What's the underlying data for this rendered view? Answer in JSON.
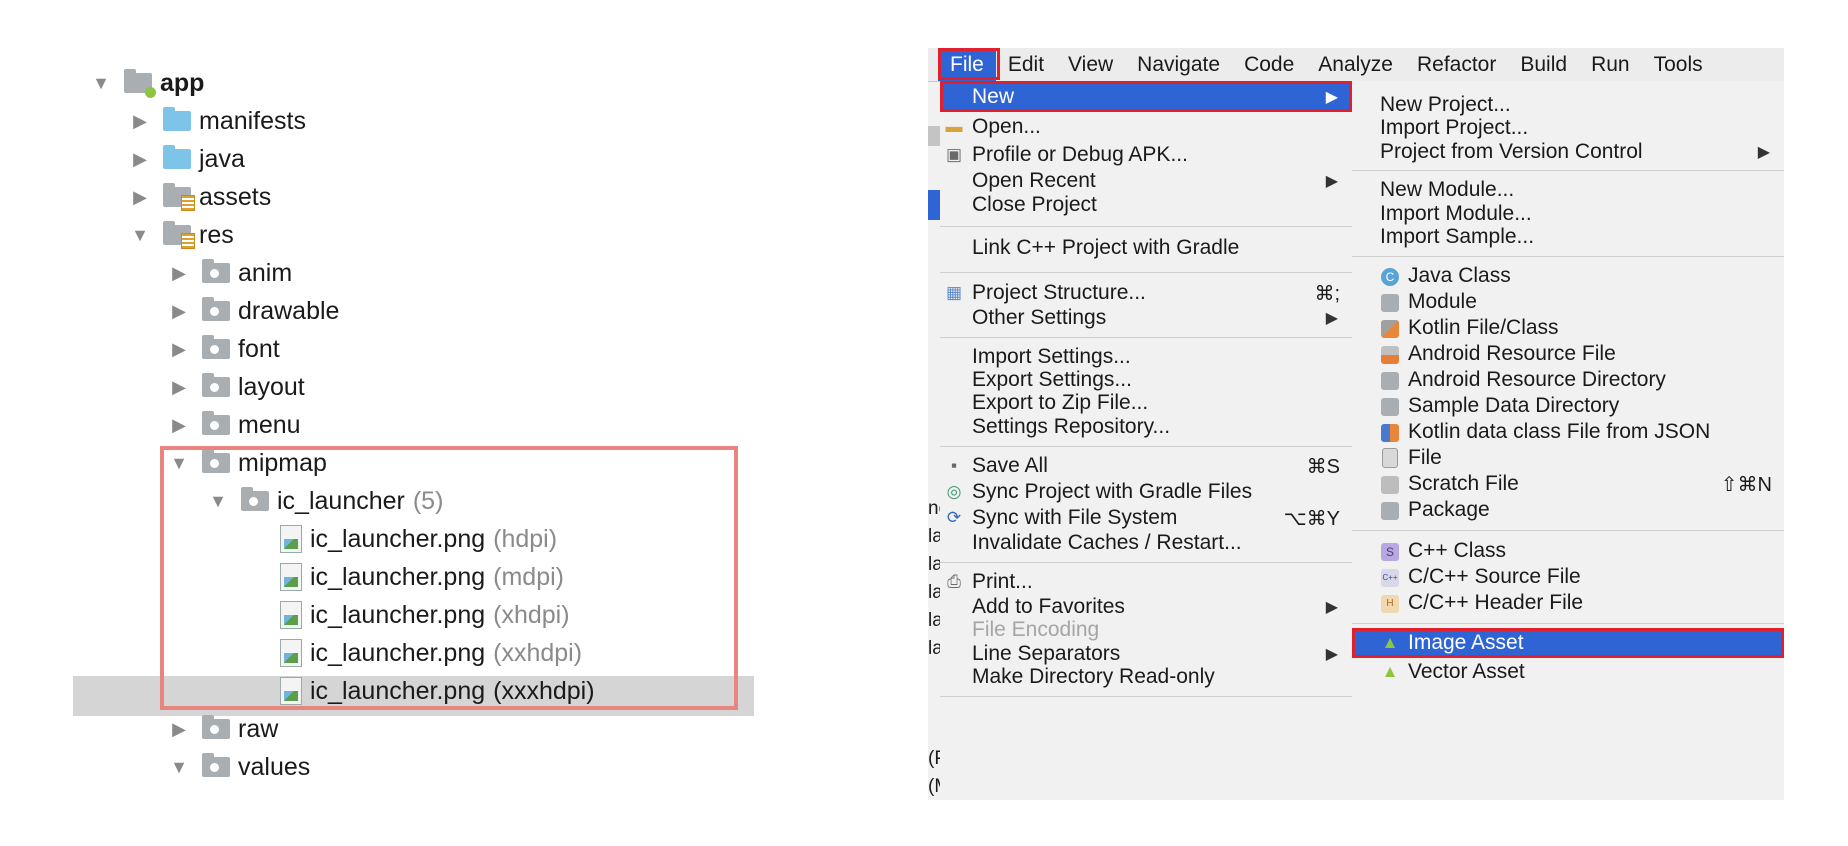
{
  "tree": {
    "rows": [
      {
        "label": "app",
        "arrow": "▼",
        "bold": true
      },
      {
        "label": "manifests",
        "arrow": "▶"
      },
      {
        "label": "java",
        "arrow": "▶"
      },
      {
        "label": "assets",
        "arrow": "▶"
      },
      {
        "label": "res",
        "arrow": "▼"
      },
      {
        "label": "anim",
        "arrow": "▶"
      },
      {
        "label": "drawable",
        "arrow": "▶"
      },
      {
        "label": "font",
        "arrow": "▶"
      },
      {
        "label": "layout",
        "arrow": "▶"
      },
      {
        "label": "menu",
        "arrow": "▶"
      },
      {
        "label": "mipmap",
        "arrow": "▼"
      },
      {
        "label": "ic_launcher",
        "arrow": "▼",
        "qualifier": "(5)"
      },
      {
        "label": "ic_launcher.png",
        "qualifier": "(hdpi)"
      },
      {
        "label": "ic_launcher.png",
        "qualifier": "(mdpi)"
      },
      {
        "label": "ic_launcher.png",
        "qualifier": "(xhdpi)"
      },
      {
        "label": "ic_launcher.png",
        "qualifier": "(xxhdpi)"
      },
      {
        "label": "ic_launcher.png",
        "qualifier": "(xxxhdpi)"
      },
      {
        "label": "raw",
        "arrow": "▶"
      },
      {
        "label": "values",
        "arrow": "▼"
      }
    ]
  },
  "menubar": [
    "File",
    "Edit",
    "View",
    "Navigate",
    "Code",
    "Analyze",
    "Refactor",
    "Build",
    "Run",
    "Tools"
  ],
  "side_fragments": [
    "nd",
    "la",
    "la",
    "la",
    "la",
    "la",
    "(P",
    "(M"
  ],
  "file_menu": {
    "items": {
      "new": {
        "label": "New",
        "submenu_glyph": "▶"
      },
      "open": {
        "label": "Open..."
      },
      "profile": {
        "label": "Profile or Debug APK..."
      },
      "open_recent": {
        "label": "Open Recent",
        "submenu_glyph": "▶"
      },
      "close_project": {
        "label": "Close Project"
      },
      "link_cpp": {
        "label": "Link C++ Project with Gradle"
      },
      "project_structure": {
        "label": "Project Structure...",
        "shortcut": "⌘;"
      },
      "other_settings": {
        "label": "Other Settings",
        "submenu_glyph": "▶"
      },
      "import_settings": {
        "label": "Import Settings..."
      },
      "export_settings": {
        "label": "Export Settings..."
      },
      "export_zip": {
        "label": "Export to Zip File..."
      },
      "settings_repo": {
        "label": "Settings Repository..."
      },
      "save_all": {
        "label": "Save All",
        "shortcut": "⌘S"
      },
      "sync_gradle": {
        "label": "Sync Project with Gradle Files"
      },
      "sync_fs": {
        "label": "Sync with File System",
        "shortcut": "⌥⌘Y"
      },
      "invalidate": {
        "label": "Invalidate Caches / Restart..."
      },
      "print": {
        "label": "Print..."
      },
      "favorites": {
        "label": "Add to Favorites",
        "submenu_glyph": "▶"
      },
      "file_encoding": {
        "label": "File Encoding"
      },
      "line_separators": {
        "label": "Line Separators",
        "submenu_glyph": "▶"
      },
      "make_readonly": {
        "label": "Make Directory Read-only"
      }
    }
  },
  "new_submenu": {
    "items": {
      "new_project": {
        "label": "New Project..."
      },
      "import_project": {
        "label": "Import Project..."
      },
      "from_vcs": {
        "label": "Project from Version Control",
        "submenu_glyph": "▶"
      },
      "new_module": {
        "label": "New Module..."
      },
      "import_module": {
        "label": "Import Module..."
      },
      "import_sample": {
        "label": "Import Sample..."
      },
      "java_class": {
        "label": "Java Class",
        "icon_glyph": "C"
      },
      "module": {
        "label": "Module"
      },
      "kotlin_file": {
        "label": "Kotlin File/Class"
      },
      "android_res_file": {
        "label": "Android Resource File"
      },
      "android_res_dir": {
        "label": "Android Resource Directory"
      },
      "sample_data_dir": {
        "label": "Sample Data Directory"
      },
      "kotlin_json": {
        "label": "Kotlin data class File from JSON"
      },
      "file": {
        "label": "File"
      },
      "scratch_file": {
        "label": "Scratch File",
        "shortcut": "⇧⌘N"
      },
      "package": {
        "label": "Package"
      },
      "cpp_class": {
        "label": "C++ Class",
        "icon_glyph": "S"
      },
      "cpp_source": {
        "label": "C/C++ Source File",
        "icon_glyph": "C++"
      },
      "cpp_header": {
        "label": "C/C++ Header File",
        "icon_glyph": "H"
      },
      "image_asset": {
        "label": "Image Asset"
      },
      "vector_asset": {
        "label": "Vector Asset"
      }
    }
  },
  "colors": {
    "menu_highlight": "#2f64d4",
    "outline_red": "#e0202c",
    "tree_highlight_box": "#e8857f",
    "tree_selection": "#d5d5d5"
  }
}
